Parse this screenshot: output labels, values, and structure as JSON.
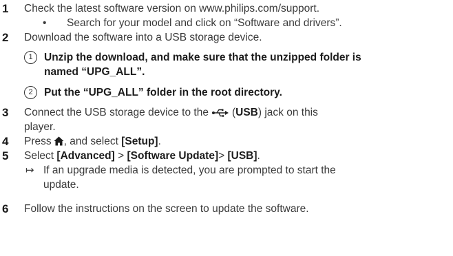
{
  "steps": {
    "s1": {
      "num": "1",
      "text": "Check the latest software version on www.philips.com/support.",
      "bullet": "•",
      "sub": "Search for your model and click on “Software and drivers”."
    },
    "s2": {
      "num": "2",
      "text": "Download the software into a USB storage device.",
      "sub1_mark": "1",
      "sub1_line1": "Unzip the download, and make sure that the unzipped folder is",
      "sub1_line2": "named “UPG_ALL”.",
      "sub2_mark": "2",
      "sub2_text": "Put the “UPG_ALL” folder in the root directory."
    },
    "s3": {
      "num": "3",
      "text_a": "Connect the USB storage device to the",
      "paren_open": "(",
      "usb": "USB",
      "text_b": ") jack on this",
      "line2": "player."
    },
    "s4": {
      "num": "4",
      "text_a": "Press",
      "text_b": ", and select",
      "setup": "[Setup]",
      "end": "."
    },
    "s5": {
      "num": "5",
      "text_a": "Select",
      "advanced": "[Advanced]",
      "gt1": " > ",
      "software_update": "[Software Update]",
      "gt2": "> ",
      "usb": "[USB]",
      "end": ".",
      "arrow": "↦",
      "result_line1": "If an upgrade media is detected, you are prompted to start the",
      "result_line2": "update."
    },
    "s6": {
      "num": "6",
      "text": "Follow the instructions on the screen to update the software."
    }
  },
  "icons": {
    "usb": "usb-icon",
    "home": "home-icon"
  }
}
